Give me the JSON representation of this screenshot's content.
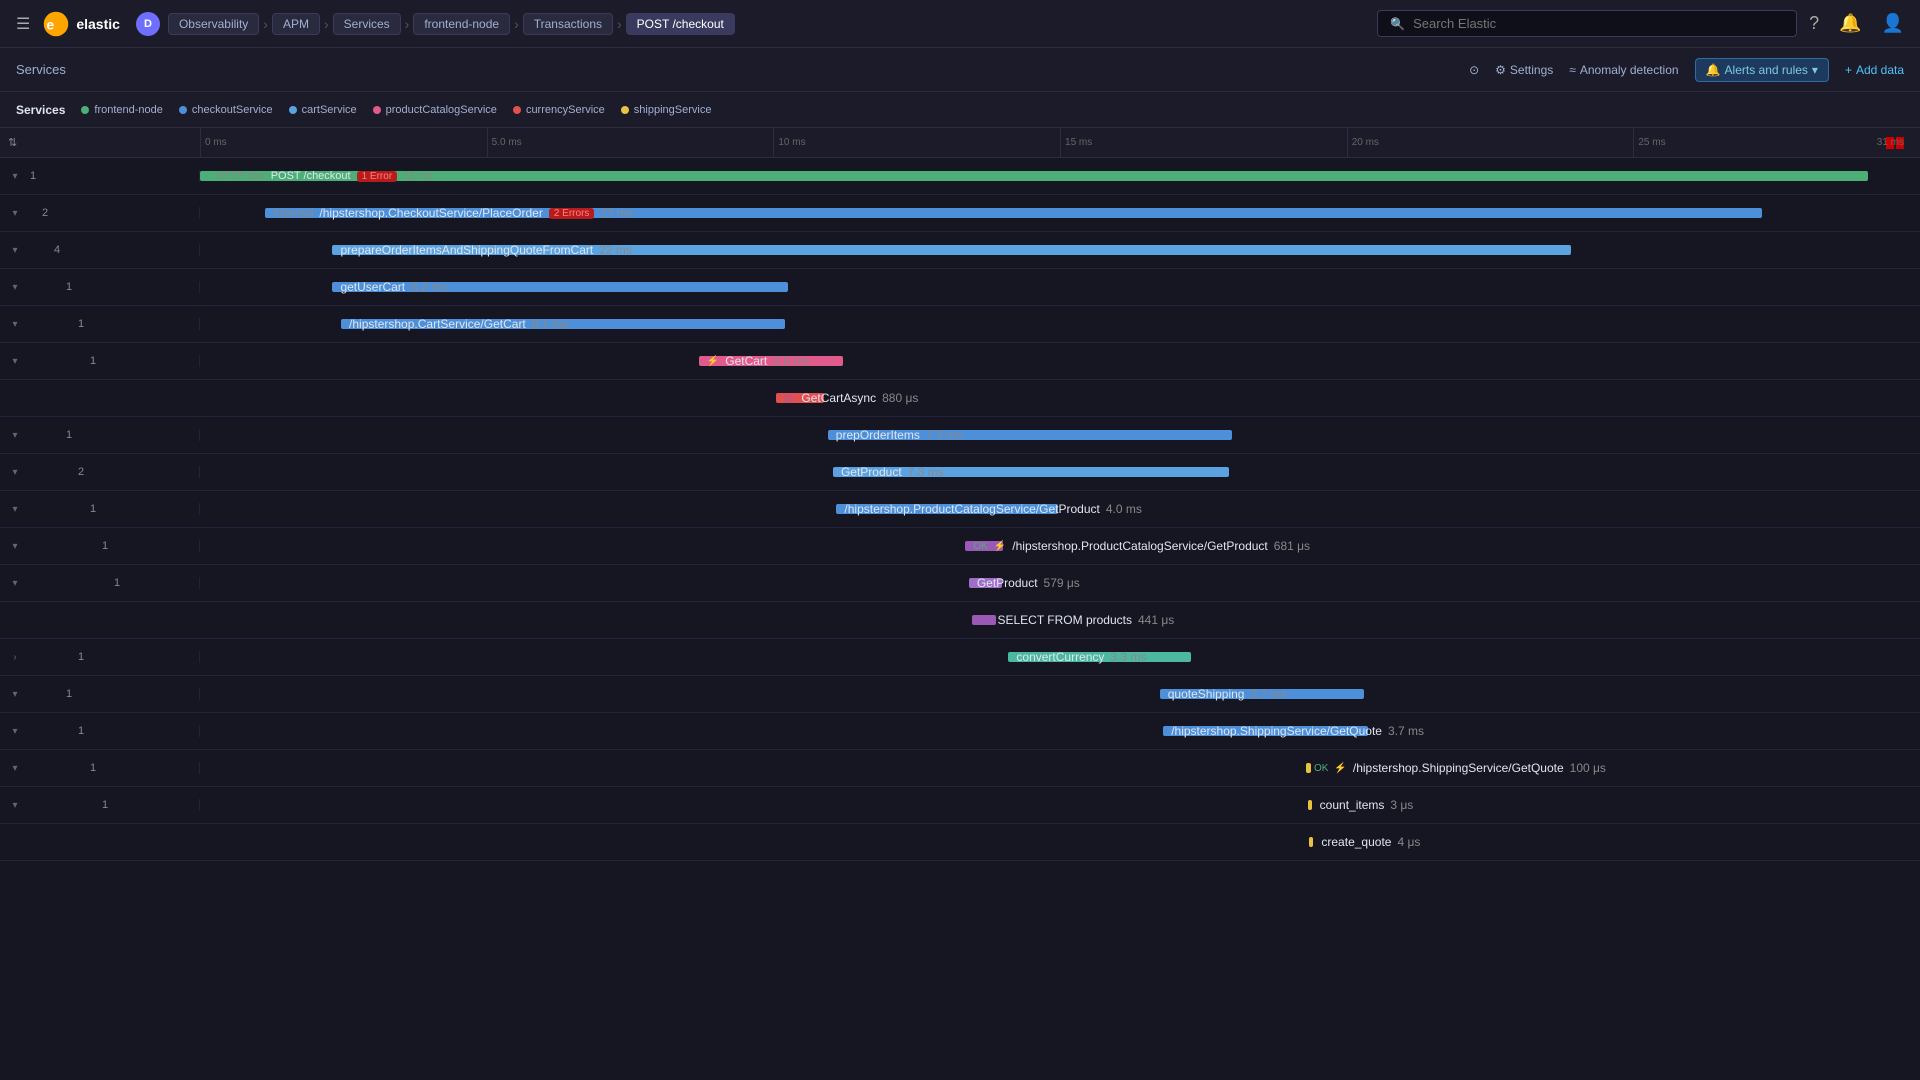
{
  "app": {
    "logo_text": "elastic",
    "hamburger_label": "☰",
    "d_badge": "D"
  },
  "breadcrumb": {
    "items": [
      {
        "label": "Observability",
        "active": false
      },
      {
        "label": "APM",
        "active": false
      },
      {
        "label": "Services",
        "active": false
      },
      {
        "label": "frontend-node",
        "active": false
      },
      {
        "label": "Transactions",
        "active": false
      },
      {
        "label": "POST /checkout",
        "active": true,
        "current": true
      }
    ]
  },
  "search": {
    "placeholder": "Search Elastic"
  },
  "nav_actions": {
    "settings_label": "Settings",
    "anomaly_label": "Anomaly detection",
    "alerts_label": "Alerts and rules",
    "add_data_label": "Add data"
  },
  "services_bar": {
    "label": "Services",
    "services": [
      {
        "name": "frontend-node",
        "color": "#4caf77"
      },
      {
        "name": "checkoutService",
        "color": "#4d90d9"
      },
      {
        "name": "cartService",
        "color": "#5ba3e0"
      },
      {
        "name": "productCatalogService",
        "color": "#e05b8b"
      },
      {
        "name": "currencyService",
        "color": "#e05050"
      },
      {
        "name": "shippingService",
        "color": "#e8c240"
      }
    ]
  },
  "timeline": {
    "ticks": [
      "0 ms",
      "5.0 ms",
      "10 ms",
      "15 ms",
      "20 ms",
      "25 ms"
    ],
    "end": "31 ms"
  },
  "trace_rows": [
    {
      "id": 1,
      "level": 0,
      "collapse": "▾",
      "count": "1",
      "span_type": "HTTP 5xx",
      "span_name": "POST /checkout",
      "span_error": "1 Error",
      "duration": "31 ms",
      "bar_color": "color-green",
      "bar_left": "0%",
      "bar_width": "97%",
      "icon": "http"
    },
    {
      "id": 2,
      "level": 1,
      "collapse": "▾",
      "count": "2",
      "span_type": "Internal",
      "span_name": "/hipstershop.CheckoutService/PlaceOrder",
      "span_errors": "2 Errors",
      "duration": "27 ms",
      "bar_color": "color-blue",
      "bar_left": "3.8%",
      "bar_width": "87%",
      "icon": "service"
    },
    {
      "id": 3,
      "level": 2,
      "collapse": "▾",
      "count": "4",
      "span_type": "",
      "span_name": "prepareOrderItemsAndShippingQuoteFromCart",
      "duration": "22 ms",
      "bar_color": "color-blue-light",
      "bar_left": "7.7%",
      "bar_width": "72%",
      "icon": ""
    },
    {
      "id": 4,
      "level": 3,
      "collapse": "▾",
      "count": "1",
      "span_type": "",
      "span_name": "getUserCart",
      "duration": "8.2 ms",
      "bar_color": "color-blue",
      "bar_left": "7.7%",
      "bar_width": "26.5%",
      "icon": ""
    },
    {
      "id": 5,
      "level": 4,
      "collapse": "▾",
      "count": "1",
      "span_type": "",
      "span_name": "/hipstershop.CartService/GetCart",
      "duration": "8.1 ms",
      "bar_color": "color-blue",
      "bar_left": "8.2%",
      "bar_width": "25.8%",
      "icon": ""
    },
    {
      "id": 6,
      "level": 5,
      "collapse": "▾",
      "count": "1",
      "span_type": "",
      "span_name": "GetCart",
      "duration": "2.6 ms",
      "bar_color": "color-pink",
      "bar_left": "29.0%",
      "bar_width": "8.4%",
      "icon": "service"
    },
    {
      "id": 7,
      "level": 6,
      "collapse": "",
      "count": "",
      "span_type": "",
      "span_name": "GetCartAsync",
      "duration": "880 μs",
      "bar_color": "color-red",
      "bar_left": "33.5%",
      "bar_width": "2.8%",
      "icon": "db"
    },
    {
      "id": 8,
      "level": 3,
      "collapse": "▾",
      "count": "1",
      "span_type": "",
      "span_name": "prepOrderItems",
      "duration": "7.3 ms",
      "bar_color": "color-blue",
      "bar_left": "36.5%",
      "bar_width": "23.5%",
      "icon": ""
    },
    {
      "id": 9,
      "level": 4,
      "collapse": "▾",
      "count": "2",
      "span_type": "",
      "span_name": "GetProduct",
      "duration": "7.3 ms",
      "bar_color": "color-blue-light",
      "bar_left": "36.8%",
      "bar_width": "23.0%",
      "icon": ""
    },
    {
      "id": 10,
      "level": 5,
      "collapse": "▾",
      "count": "1",
      "span_type": "",
      "span_name": "/hipstershop.ProductCatalogService/GetProduct",
      "duration": "4.0 ms",
      "bar_color": "color-blue",
      "bar_left": "37.0%",
      "bar_width": "12.9%",
      "icon": ""
    },
    {
      "id": 11,
      "level": 6,
      "collapse": "▾",
      "count": "1",
      "span_type": "OK",
      "span_name": "/hipstershop.ProductCatalogService/GetProduct",
      "duration": "681 μs",
      "bar_color": "color-purple",
      "bar_left": "44.5%",
      "bar_width": "2.2%",
      "icon": "service"
    },
    {
      "id": 12,
      "level": 7,
      "collapse": "▾",
      "count": "1",
      "span_type": "",
      "span_name": "GetProduct",
      "duration": "579 μs",
      "bar_color": "color-purple-light",
      "bar_left": "44.7%",
      "bar_width": "1.9%",
      "icon": ""
    },
    {
      "id": 13,
      "level": 8,
      "collapse": "",
      "count": "",
      "span_type": "",
      "span_name": "SELECT FROM products",
      "duration": "441 μs",
      "bar_color": "color-purple",
      "bar_left": "44.9%",
      "bar_width": "1.4%",
      "icon": "db"
    },
    {
      "id": 14,
      "level": 4,
      "collapse": ">",
      "count": "1",
      "span_type": "",
      "span_name": "convertCurrency",
      "duration": "3.3 ms",
      "bar_color": "color-teal",
      "bar_left": "47.0%",
      "bar_width": "10.6%",
      "icon": ""
    },
    {
      "id": 15,
      "level": 3,
      "collapse": "▾",
      "count": "1",
      "span_type": "",
      "span_name": "quoteShipping",
      "duration": "3.7 ms",
      "bar_color": "color-blue",
      "bar_left": "55.8%",
      "bar_width": "11.9%",
      "icon": ""
    },
    {
      "id": 16,
      "level": 4,
      "collapse": "▾",
      "count": "1",
      "span_type": "",
      "span_name": "/hipstershop.ShippingService/GetQuote",
      "duration": "3.7 ms",
      "bar_color": "color-blue",
      "bar_left": "56.0%",
      "bar_width": "11.9%",
      "icon": ""
    },
    {
      "id": 17,
      "level": 5,
      "collapse": "▾",
      "count": "1",
      "span_type": "OK",
      "span_name": "/hipstershop.ShippingService/GetQuote",
      "duration": "100 μs",
      "bar_color": "color-yellow",
      "bar_left": "64.3%",
      "bar_width": "0.32%",
      "icon": "service"
    },
    {
      "id": 18,
      "level": 6,
      "collapse": "▾",
      "count": "1",
      "span_type": "",
      "span_name": "count_items",
      "duration": "3 μs",
      "bar_color": "color-yellow",
      "bar_left": "64.4%",
      "bar_width": "0.1%",
      "icon": ""
    },
    {
      "id": 19,
      "level": 7,
      "collapse": "",
      "count": "",
      "span_type": "",
      "span_name": "create_quote",
      "duration": "4 μs",
      "bar_color": "color-yellow",
      "bar_left": "64.5%",
      "bar_width": "0.13%",
      "icon": ""
    }
  ]
}
